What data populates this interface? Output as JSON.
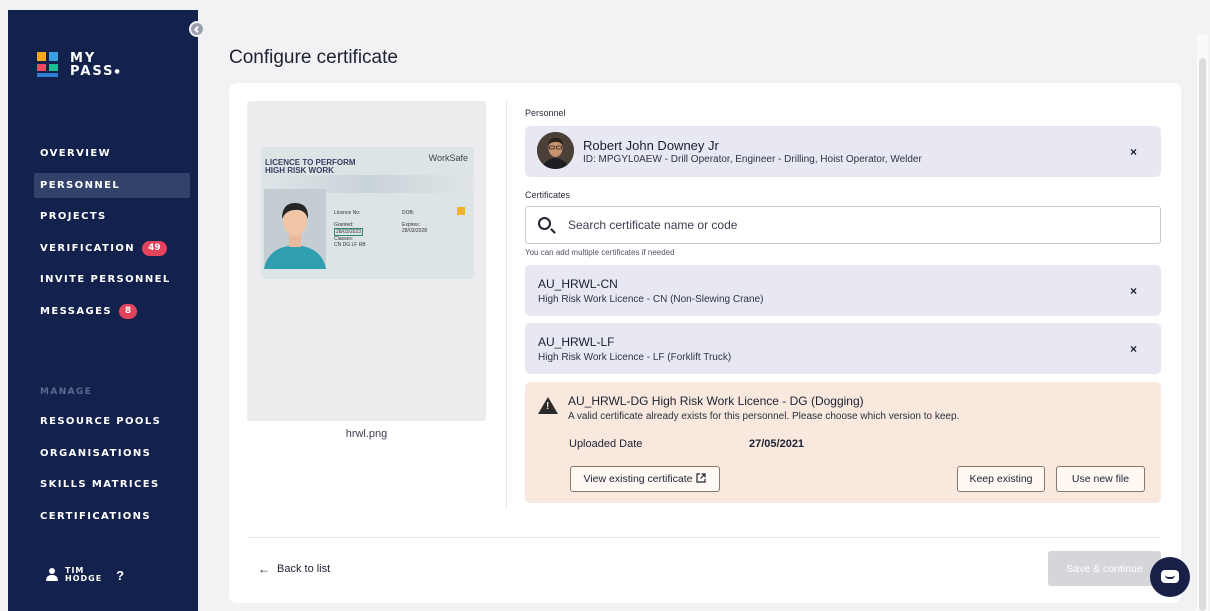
{
  "app": {
    "logo_line1": "MY",
    "logo_line2": "PASS"
  },
  "sidebar": {
    "nav": [
      {
        "label": "OVERVIEW"
      },
      {
        "label": "PERSONNEL"
      },
      {
        "label": "PROJECTS"
      },
      {
        "label": "VERIFICATION",
        "badge": "49"
      },
      {
        "label": "INVITE PERSONNEL"
      },
      {
        "label": "MESSAGES",
        "badge": "8"
      }
    ],
    "section_manage": "MANAGE",
    "manage": [
      {
        "label": "RESOURCE POOLS"
      },
      {
        "label": "ORGANISATIONS"
      },
      {
        "label": "SKILLS MATRICES"
      },
      {
        "label": "CERTIFICATIONS"
      }
    ],
    "user": {
      "first": "TIM",
      "last": "HODGE"
    },
    "help": "?"
  },
  "page": {
    "title": "Configure certificate"
  },
  "preview": {
    "filename": "hrwl.png",
    "licence_title_1": "LICENCE TO PERFORM",
    "licence_title_2": "HIGH RISK WORK",
    "brand": "WorkSafe",
    "f_licence_no": "Licence No:",
    "f_granted": "Granted:",
    "f_granted_val": "28/03/2023",
    "f_classes": "Classes:",
    "f_classes_val": "CN DG LF RB",
    "f_dob": "DOB:",
    "f_expires": "Expires:",
    "f_expires_val": "28/03/2028"
  },
  "personnel": {
    "label": "Personnel",
    "name": "Robert John Downey Jr",
    "id_line": "ID: MPGYL0AEW - Drill Operator, Engineer - Drilling, Hoist Operator, Welder",
    "remove": "×"
  },
  "certificates": {
    "label": "Certificates",
    "search_placeholder": "Search certificate name or code",
    "hint": "You can add multiple certificates if needed",
    "items": [
      {
        "code": "AU_HRWL-CN",
        "name": "High Risk Work Licence - CN (Non-Slewing Crane)",
        "remove": "×"
      },
      {
        "code": "AU_HRWL-LF",
        "name": "High Risk Work Licence - LF (Forklift Truck)",
        "remove": "×"
      }
    ]
  },
  "warning": {
    "title": "AU_HRWL-DG High Risk Work Licence - DG (Dogging)",
    "text": "A valid certificate already exists for this personnel. Please choose which version to keep.",
    "uploaded_label": "Uploaded Date",
    "uploaded_value": "27/05/2021",
    "view_button": "View existing certificate",
    "keep_button": "Keep existing",
    "use_button": "Use new file"
  },
  "footer": {
    "back_label": "Back to list",
    "save_label": "Save & continue"
  },
  "colors": {
    "sidebar": "#13214d",
    "badge": "#e2445c",
    "box": "#e7e8f2",
    "warning": "#f8e8de"
  }
}
